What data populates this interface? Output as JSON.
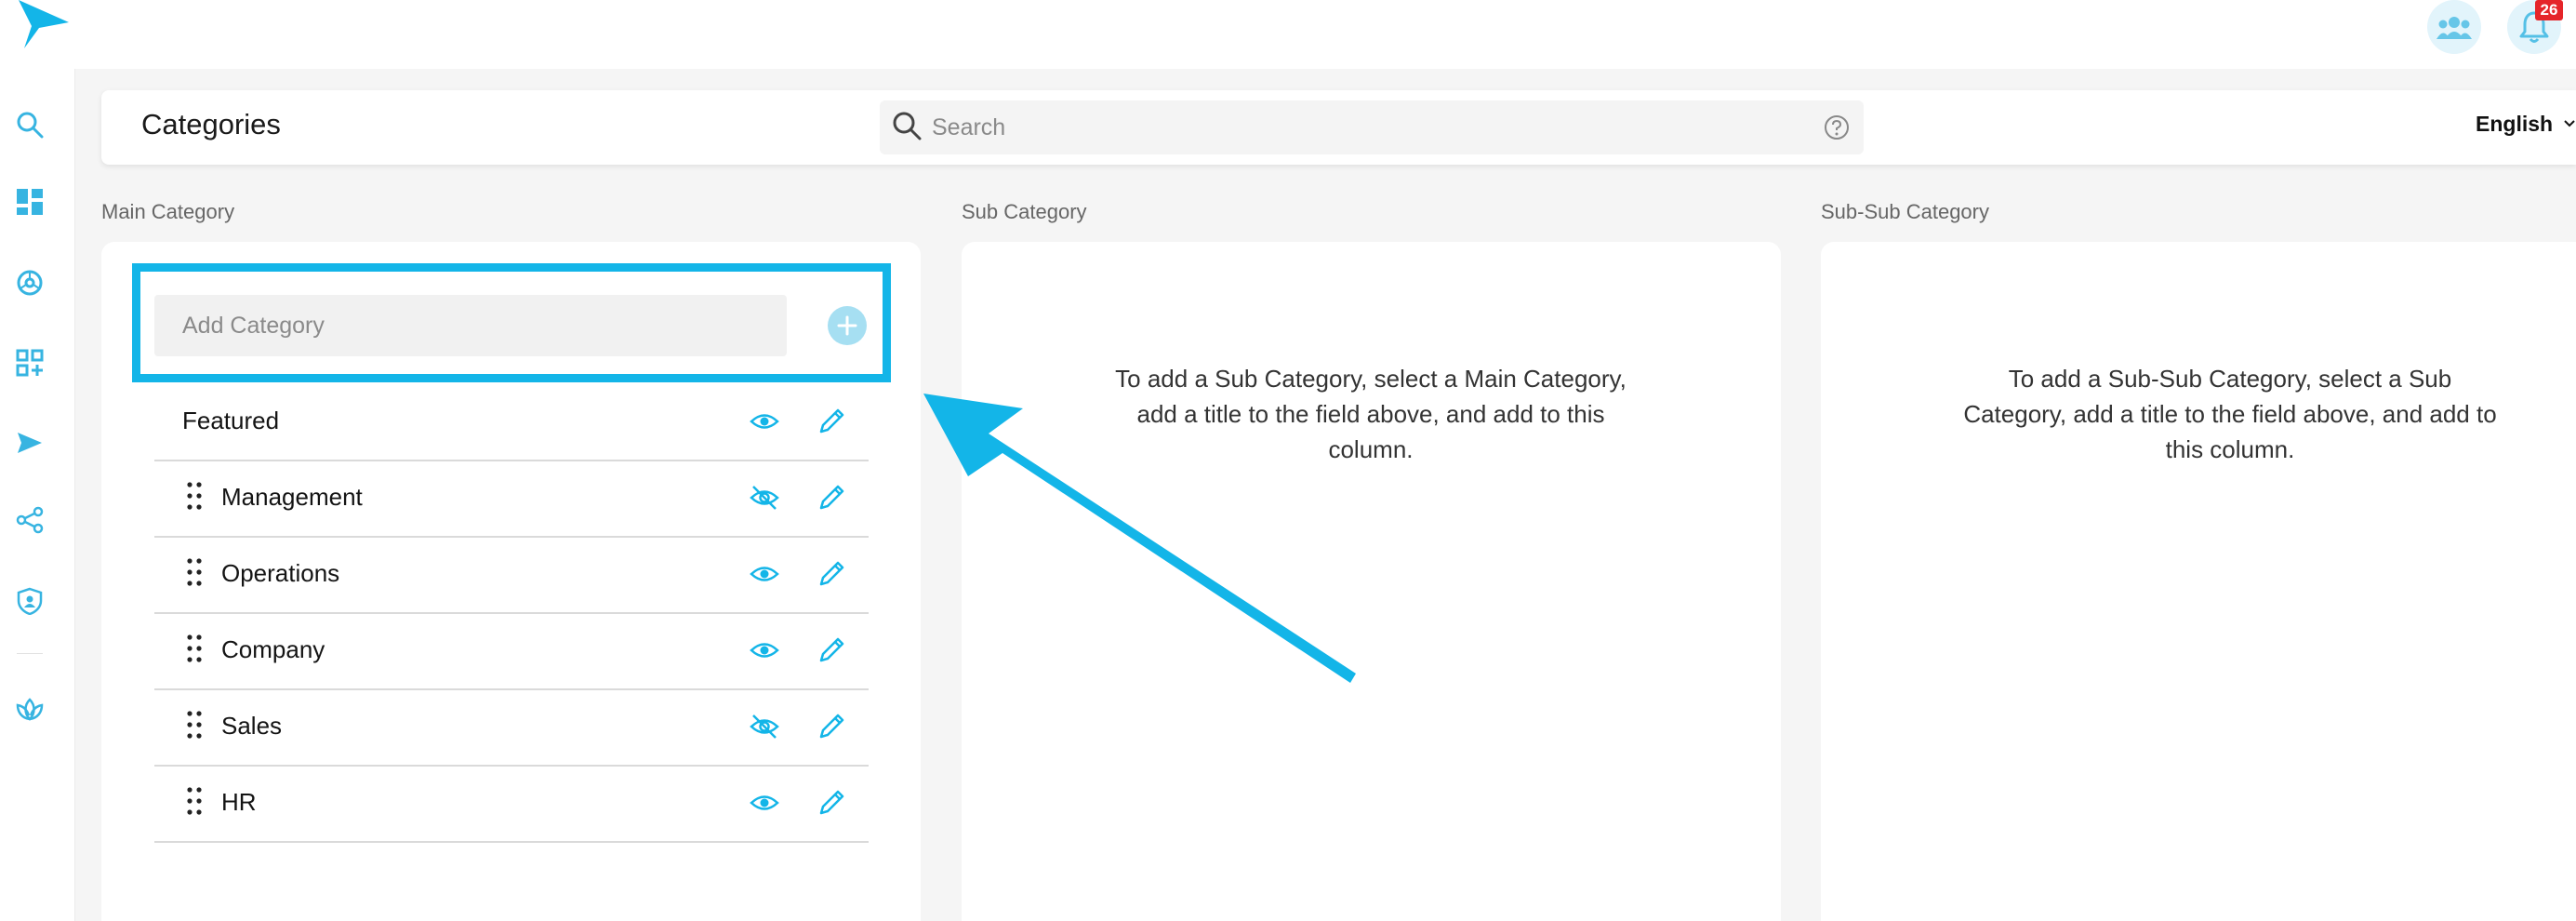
{
  "header": {
    "title": "Categories",
    "search_placeholder": "Search",
    "language": "English",
    "notification_count": "26"
  },
  "columns": {
    "main_label": "Main Category",
    "sub_label": "Sub Category",
    "subsub_label": "Sub-Sub Category"
  },
  "main": {
    "add_placeholder": "Add Category",
    "items": [
      {
        "label": "Featured",
        "visible": true
      },
      {
        "label": "Management",
        "visible": false
      },
      {
        "label": "Operations",
        "visible": true
      },
      {
        "label": "Company",
        "visible": true
      },
      {
        "label": "Sales",
        "visible": false
      },
      {
        "label": "HR",
        "visible": true
      }
    ]
  },
  "sub": {
    "empty_message": "To add a Sub Category, select a Main Category, add a title to the field above, and add to this column."
  },
  "subsub": {
    "empty_message": "To add a Sub-Sub Category, select a Sub Category, add a title to the field above, and add to this column."
  },
  "colors": {
    "accent": "#13b5e8",
    "badge": "#e5252a",
    "page_background": "#f5f5f5"
  },
  "icons": {
    "sidebar": [
      "search-icon",
      "dashboard-icon",
      "explore-icon",
      "add-widget-icon",
      "send-icon",
      "share-icon",
      "shield-user-icon",
      "lotus-icon"
    ],
    "topbar": [
      "team-icon",
      "bell-icon"
    ]
  }
}
